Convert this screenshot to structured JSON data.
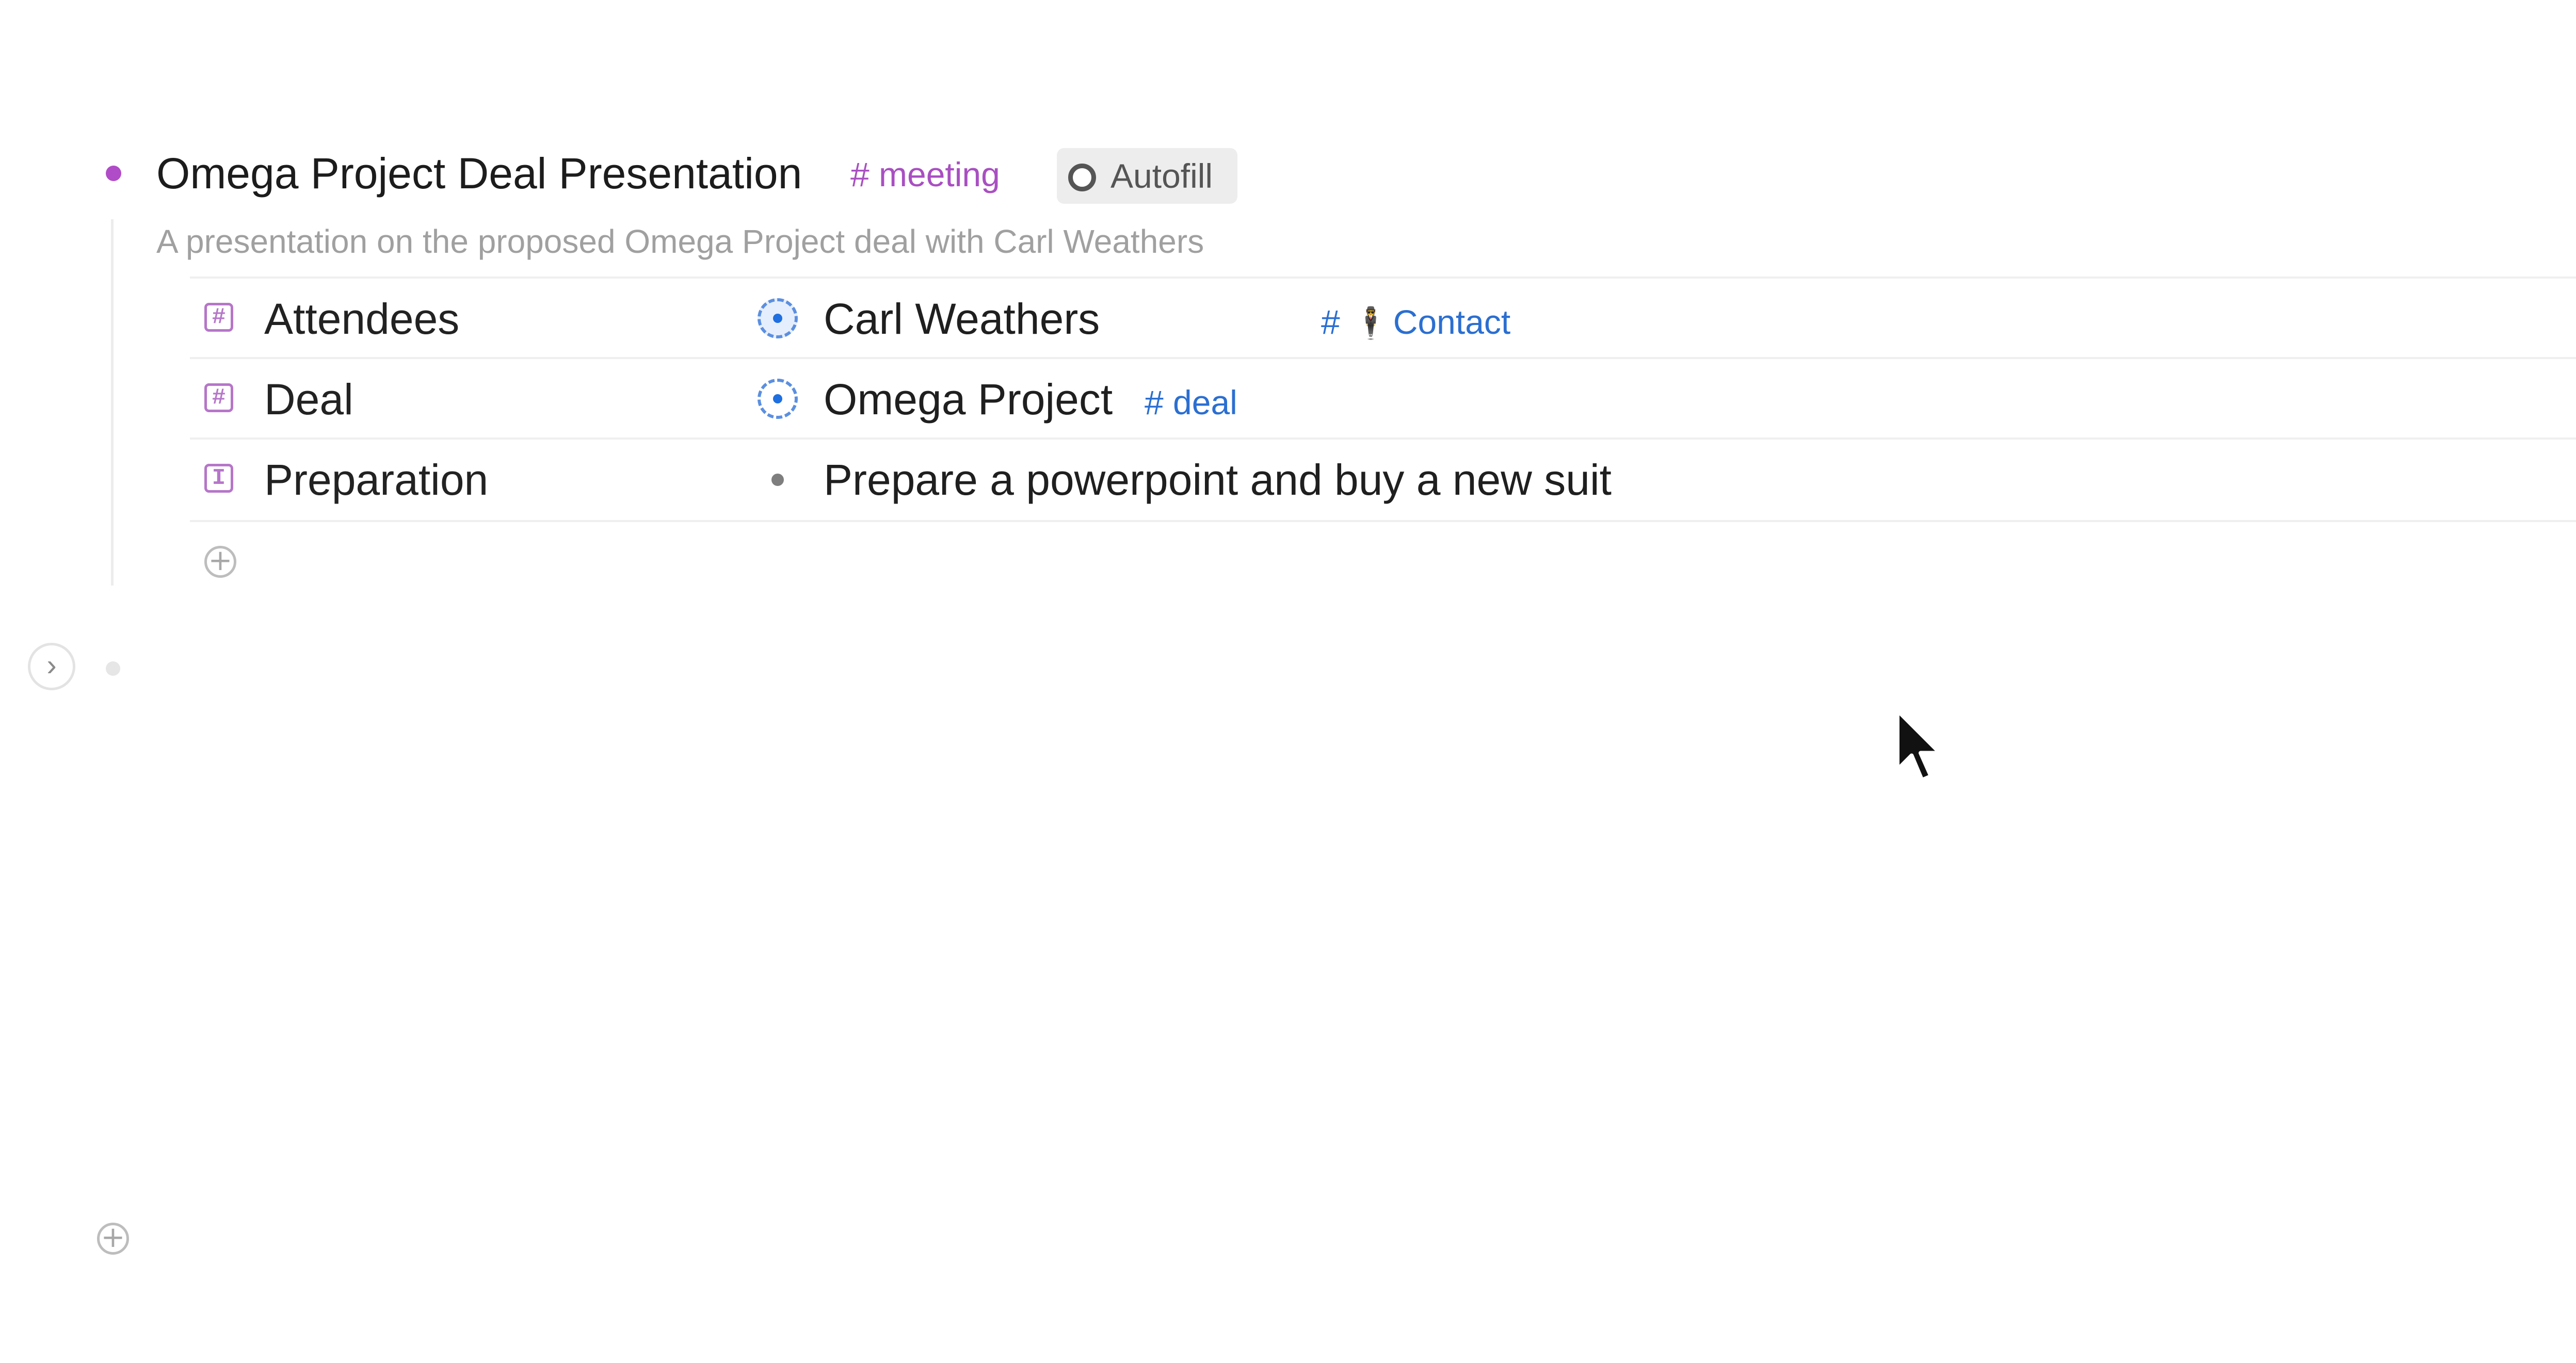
{
  "node": {
    "title": "Omega Project Deal Presentation",
    "tag": "# meeting",
    "autofill_label": "Autofill",
    "description": "A presentation on the proposed Omega Project deal with Carl Weathers"
  },
  "fields": [
    {
      "label": "Attendees",
      "field_icon": "hash-icon",
      "value": "Carl Weathers",
      "value_tag_prefix": "#",
      "value_tag_emoji": "🕴",
      "value_tag": "Contact"
    },
    {
      "label": "Deal",
      "field_icon": "hash-icon",
      "value": "Omega Project",
      "value_tag": "# deal"
    },
    {
      "label": "Preparation",
      "field_icon": "text-field-icon",
      "value": "Prepare a powerpoint and buy a new suit"
    }
  ],
  "icons": {
    "add": "plus-circle-icon",
    "expand": "chevron-right-icon",
    "hash_glyph": "#",
    "text_glyph": "I",
    "chevron_glyph": "›",
    "plus_glyph": "+"
  },
  "colors": {
    "accent_purple": "#b04cc7",
    "tag_blue": "#2b6fd1",
    "muted_text": "#a0a0a0"
  }
}
